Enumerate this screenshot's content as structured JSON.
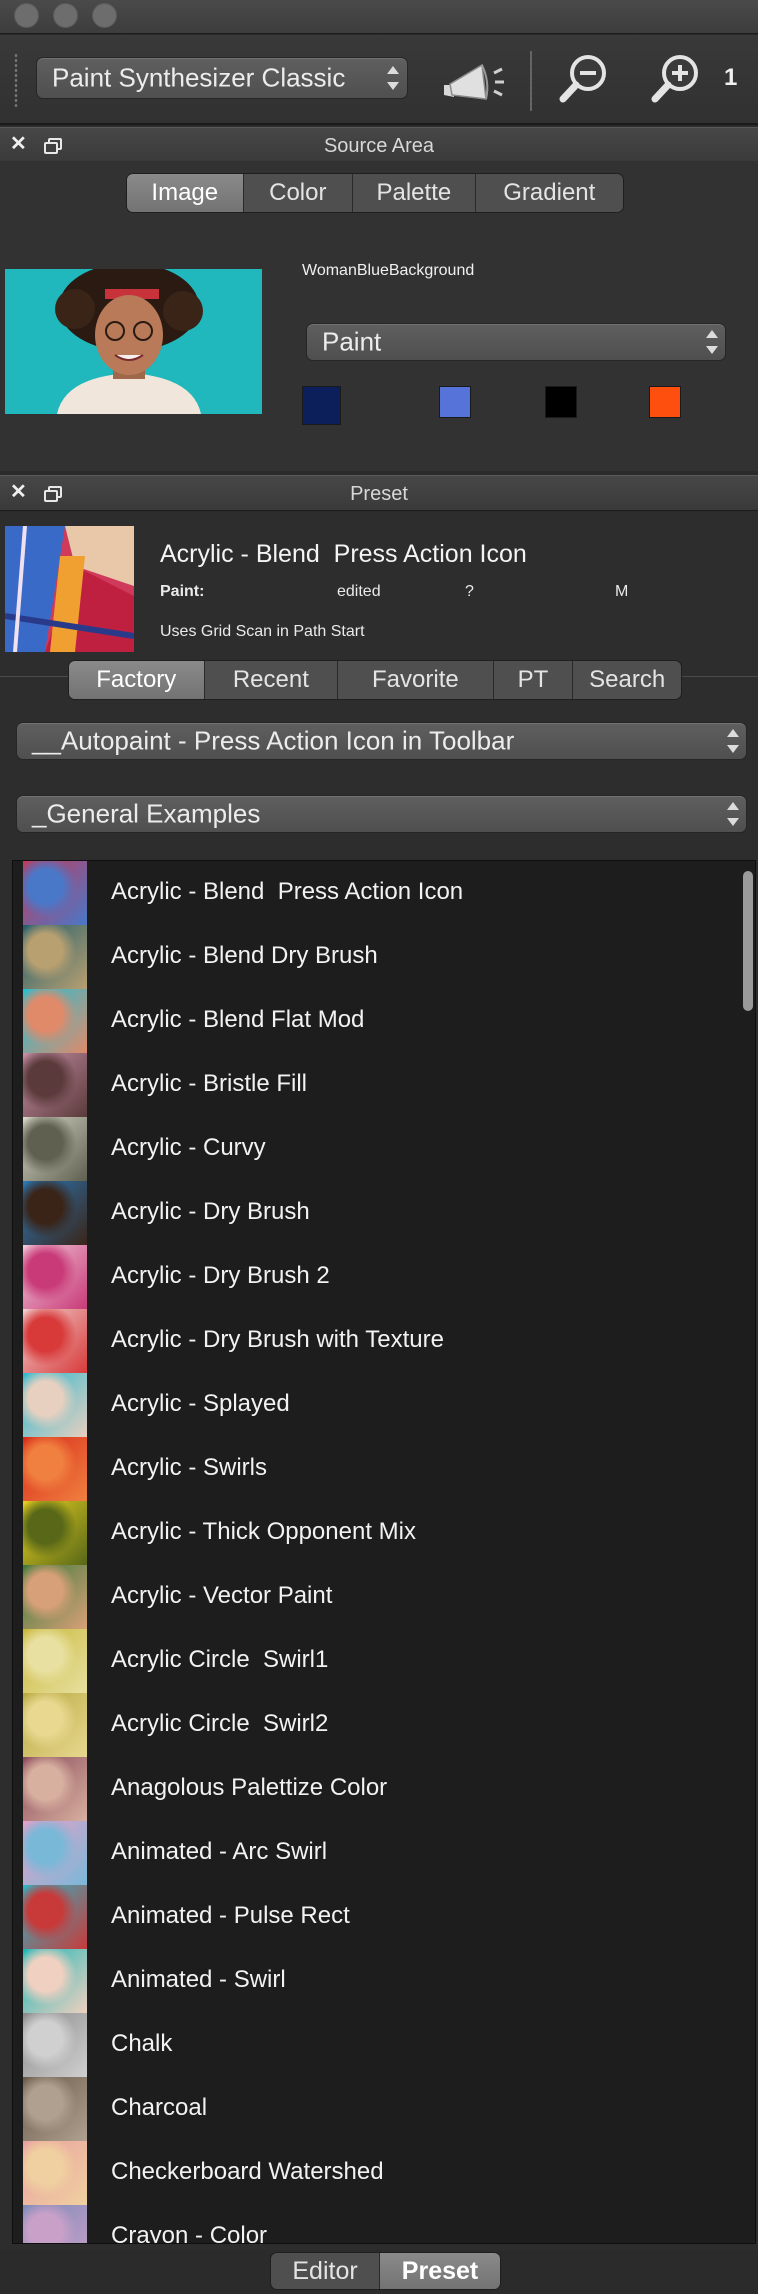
{
  "toolbar": {
    "mode_select": "Paint Synthesizer Classic",
    "zoom_count": "1",
    "icons": [
      "megaphone-icon",
      "zoom-out-icon",
      "zoom-in-icon"
    ]
  },
  "source_area": {
    "title": "Source Area",
    "tabs": [
      {
        "label": "Image",
        "active": true
      },
      {
        "label": "Color",
        "active": false
      },
      {
        "label": "Palette",
        "active": false
      },
      {
        "label": "Gradient",
        "active": false
      }
    ],
    "image_name": "WomanBlueBackground",
    "paint_select": "Paint",
    "swatches": [
      "#0c1f5a",
      "#5573d8",
      "#000000",
      "#ff4f0f"
    ]
  },
  "preset": {
    "title": "Preset",
    "current_name": "Acrylic - Blend  Press Action Icon",
    "paint_label": "Paint:",
    "paint_status": "edited",
    "paint_unknown": "?",
    "paint_letter": "M",
    "description": "Uses Grid Scan in Path Start",
    "tabs": [
      {
        "label": "Factory",
        "active": true
      },
      {
        "label": "Recent",
        "active": false
      },
      {
        "label": "Favorite",
        "active": false
      },
      {
        "label": "PT",
        "active": false
      },
      {
        "label": "Search",
        "active": false
      }
    ],
    "autopaint_select": "__Autopaint - Press Action Icon in Toolbar",
    "category_select": "_General Examples",
    "items": [
      {
        "label": "Acrylic - Blend  Press Action Icon",
        "c1": "#c23a5a",
        "c2": "#4a78c8"
      },
      {
        "label": "Acrylic - Blend Dry Brush",
        "c1": "#1e5c6e",
        "c2": "#b8a070"
      },
      {
        "label": "Acrylic - Blend Flat Mod",
        "c1": "#1ec2d8",
        "c2": "#e08a6a"
      },
      {
        "label": "Acrylic - Bristle Fill",
        "c1": "#c890a8",
        "c2": "#5a3a3a"
      },
      {
        "label": "Acrylic - Curvy",
        "c1": "#d8d8c8",
        "c2": "#606050"
      },
      {
        "label": "Acrylic - Dry Brush",
        "c1": "#2a7ab8",
        "c2": "#3a2418"
      },
      {
        "label": "Acrylic - Dry Brush 2",
        "c1": "#f0c8d8",
        "c2": "#c83a78"
      },
      {
        "label": "Acrylic - Dry Brush with Texture",
        "c1": "#f0d0d0",
        "c2": "#d83a3a"
      },
      {
        "label": "Acrylic - Splayed",
        "c1": "#2ab8d0",
        "c2": "#e8d0c0"
      },
      {
        "label": "Acrylic - Swirls",
        "c1": "#d82a1a",
        "c2": "#f08040"
      },
      {
        "label": "Acrylic - Thick Opponent Mix",
        "c1": "#e8d020",
        "c2": "#586818"
      },
      {
        "label": "Acrylic - Vector Paint",
        "c1": "#3a7a3a",
        "c2": "#d8a078"
      },
      {
        "label": "Acrylic Circle  Swirl1",
        "c1": "#c8b83a",
        "c2": "#e8e0a0"
      },
      {
        "label": "Acrylic Circle  Swirl2",
        "c1": "#b8a840",
        "c2": "#e8d890"
      },
      {
        "label": "Anagolous Palettize Color",
        "c1": "#8a4a5a",
        "c2": "#d8b0a0"
      },
      {
        "label": "Animated - Arc Swirl",
        "c1": "#e8a0c8",
        "c2": "#7ab8d8"
      },
      {
        "label": "Animated - Pulse Rect",
        "c1": "#2ab8c8",
        "c2": "#c83a3a"
      },
      {
        "label": "Animated - Swirl",
        "c1": "#18b8b8",
        "c2": "#f0d0c0"
      },
      {
        "label": "Chalk",
        "c1": "#8a8a8a",
        "c2": "#d0d0d0"
      },
      {
        "label": "Charcoal",
        "c1": "#6a5a4a",
        "c2": "#b0a090"
      },
      {
        "label": "Checkerboard Watershed",
        "c1": "#e8a0a0",
        "c2": "#f0d0a0"
      },
      {
        "label": "Crayon - Color",
        "c1": "#7a8ab8",
        "c2": "#c8a0c8"
      }
    ]
  },
  "bottom_tabs": [
    {
      "label": "Editor",
      "active": false
    },
    {
      "label": "Preset",
      "active": true
    }
  ]
}
